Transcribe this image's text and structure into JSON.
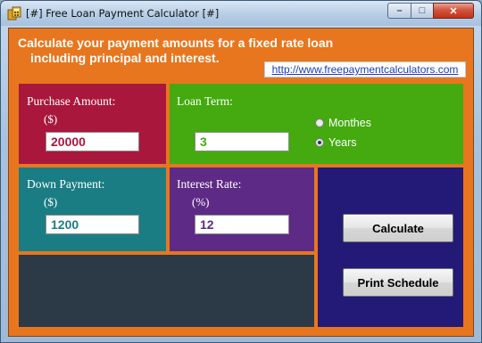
{
  "window": {
    "title": "[#] Free Loan Payment Calculator [#]",
    "controls": {
      "minimize": "–",
      "maximize": "□",
      "close": "✕"
    }
  },
  "header": {
    "line1": "Calculate your payment amounts for a fixed rate loan",
    "line2": "including principal and interest.",
    "link_text": "http://www.freepaymentcalculators.com"
  },
  "purchase": {
    "label": "Purchase Amount:",
    "unit": "($)",
    "value": "20000",
    "color": "#a9173c"
  },
  "term": {
    "label": "Loan Term:",
    "value": "3",
    "options": [
      {
        "label": "Monthes",
        "selected": false
      },
      {
        "label": "Years",
        "selected": true
      }
    ],
    "color": "#44aa0f"
  },
  "down": {
    "label": "Down Payment:",
    "unit": "($)",
    "value": "1200",
    "color": "#1a7d84"
  },
  "rate": {
    "label": "Interest Rate:",
    "unit": "(%)",
    "value": "12",
    "color": "#5d2a86"
  },
  "buttons": {
    "calculate": "Calculate",
    "print": "Print Schedule"
  },
  "colors": {
    "background": "#e8761e",
    "buttons_panel": "#231977",
    "result_panel": "#2c3a47",
    "purchase_value": "#a9173c",
    "term_value": "#44aa0f",
    "down_value": "#1a7d84",
    "rate_value": "#5d2a86"
  }
}
